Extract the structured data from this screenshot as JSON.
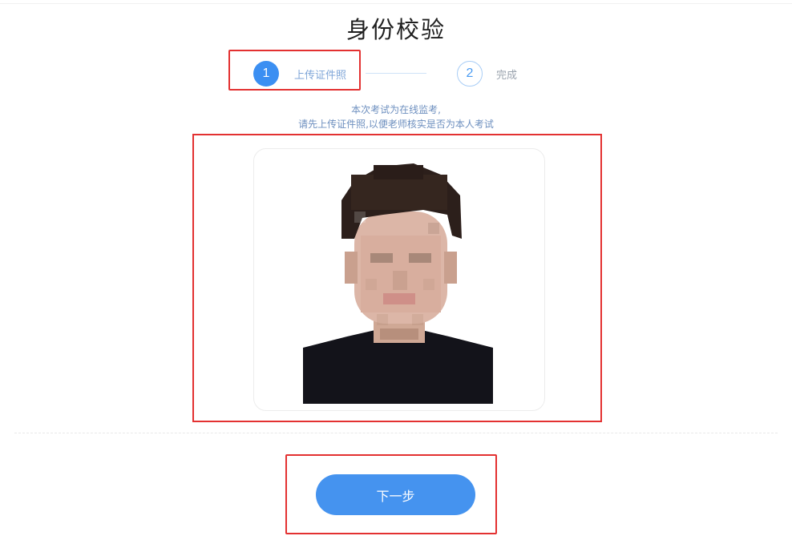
{
  "page": {
    "title": "身份校验"
  },
  "steps": [
    {
      "number": "1",
      "label": "上传证件照",
      "state": "active"
    },
    {
      "number": "2",
      "label": "完成",
      "state": "pending"
    }
  ],
  "notice": {
    "line1": "本次考试为在线监考,",
    "line2": "请先上传证件照,以便老师核实是否为本人考试"
  },
  "photo": {
    "kind": "uploaded-id-photo",
    "pixelated": true
  },
  "actions": {
    "next_label": "下一步"
  },
  "colors": {
    "accent": "#4593ef",
    "highlight": "#e33131",
    "notice_text": "#6d8fbf"
  }
}
